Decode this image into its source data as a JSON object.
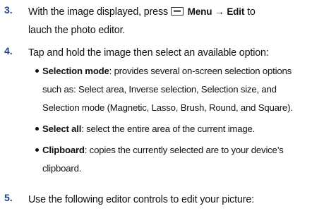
{
  "steps": [
    {
      "number": "3.",
      "line1_before": "With the image displayed, press",
      "menu": "Menu",
      "arrow": "→",
      "edit": "Edit",
      "line1_after": "to",
      "line2": "lauch the photo editor.",
      "icon": "menu-key-icon"
    },
    {
      "number": "4.",
      "text": "Tap and hold the image then select an available option:"
    },
    {
      "number": "5.",
      "text": "Use the following editor controls to edit your picture:"
    }
  ],
  "options": [
    {
      "term": "Selection mode",
      "lines": [
        ": provides several on-screen selection options",
        "such as: Select area, Inverse selection, Selection size, and",
        "Selection mode (Magnetic, Lasso, Brush, Round, and Square)."
      ]
    },
    {
      "term": "Select all",
      "lines": [
        ": select the entire area of the current image."
      ]
    },
    {
      "term": "Clipboard",
      "lines": [
        ": copies the currently selected are to your device’s",
        "clipboard."
      ]
    }
  ]
}
